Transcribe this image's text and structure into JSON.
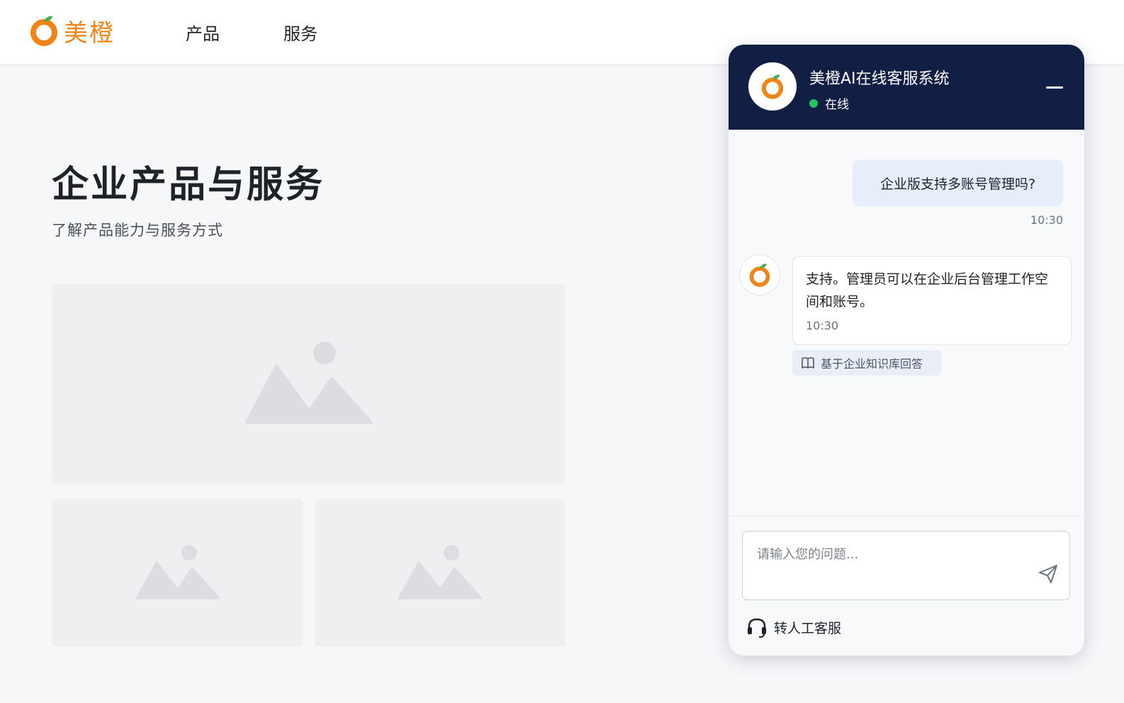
{
  "brand": {
    "name": "美橙",
    "color": "#f28417",
    "logo_icon": "orange-icon"
  },
  "nav": {
    "items": [
      {
        "label": "产品"
      },
      {
        "label": "服务"
      }
    ]
  },
  "main": {
    "title": "企业产品与服务",
    "subtitle": "了解产品能力与服务方式",
    "image_placeholder_icon": "image-placeholder-icon"
  },
  "chat": {
    "title": "美橙AI在线客服系统",
    "status": "在线",
    "status_color": "#22c55e",
    "header_color": "#111f45",
    "minimize_icon": "minimize-icon",
    "messages": [
      {
        "role": "user",
        "text": "企业版支持多账号管理吗?",
        "time": "10:30"
      },
      {
        "role": "bot",
        "text": "支持。管理员可以在企业后台管理工作空间和账号。",
        "time": "10:30",
        "source_tag": "基于企业知识库回答"
      }
    ],
    "input": {
      "placeholder": "请输入您的问题...",
      "value": ""
    },
    "send_icon": "send-icon",
    "human_handoff": {
      "label": "转人工客服",
      "icon": "headset-icon"
    }
  }
}
